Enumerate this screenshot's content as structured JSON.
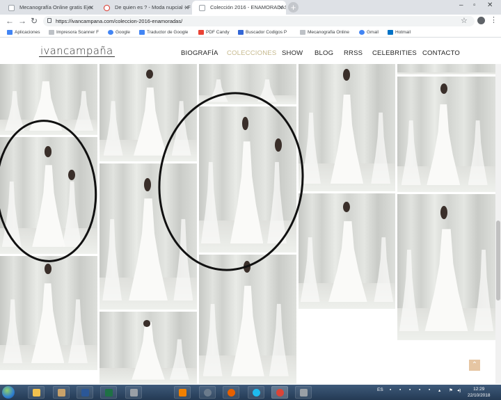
{
  "browser": {
    "tabs": [
      {
        "title": "Mecanografía Online gratis Ejer"
      },
      {
        "title": "De quien es ? - Moda nupcial - F"
      },
      {
        "title": "Colección 2016 - ENAMORADAS",
        "active": true
      }
    ],
    "url": "https://ivancampana.com/coleccion-2016-enamoradas/",
    "bookmarks": [
      {
        "label": "Aplicaciones",
        "icon": "apps-grid-icon",
        "color": "#4285f4"
      },
      {
        "label": "Impresora Scanner F",
        "icon": "page-icon",
        "color": "#9aa0a6"
      },
      {
        "label": "Google",
        "icon": "google-icon",
        "color": "#4285f4"
      },
      {
        "label": "Traductor de Google",
        "icon": "translate-icon",
        "color": "#4285f4"
      },
      {
        "label": "PDF Candy",
        "icon": "candy-icon",
        "color": "#ea4335"
      },
      {
        "label": "Buscador Codigos P",
        "icon": "search-puzzle-icon",
        "color": "#3367d6"
      },
      {
        "label": "Mecanografia Online",
        "icon": "page-icon",
        "color": "#9aa0a6"
      },
      {
        "label": "Gmail",
        "icon": "google-icon",
        "color": "#4285f4"
      },
      {
        "label": "Hotmail",
        "icon": "outlook-icon",
        "color": "#0072c6"
      }
    ]
  },
  "site": {
    "logo": "ivancampaña",
    "nav": [
      {
        "label": "BIOGRAFÍA"
      },
      {
        "label": "COLECCIONES",
        "active": true
      },
      {
        "label": "SHOW"
      },
      {
        "label": "BLOG"
      },
      {
        "label": "RRSS"
      },
      {
        "label": "CELEBRITIES"
      },
      {
        "label": "CONTACTO"
      }
    ],
    "accent_color": "#c6b98d"
  },
  "gallery": {
    "photos": [
      {
        "name": "photo-col1-1"
      },
      {
        "name": "photo-col1-2",
        "circled": true
      },
      {
        "name": "photo-col1-3"
      },
      {
        "name": "photo-col2-1"
      },
      {
        "name": "photo-col2-2"
      },
      {
        "name": "photo-col2-3"
      },
      {
        "name": "photo-col3-1"
      },
      {
        "name": "photo-col3-2",
        "circled": true
      },
      {
        "name": "photo-col3-3"
      },
      {
        "name": "photo-col4-1"
      },
      {
        "name": "photo-col4-2"
      },
      {
        "name": "photo-col5-1"
      },
      {
        "name": "photo-col5-2"
      },
      {
        "name": "photo-col5-3"
      }
    ],
    "back_to_top_icon": "chevron-up-icon"
  },
  "taskbar": {
    "language": "ES",
    "time": "12:29",
    "date": "22/10/2018",
    "apps": [
      "explorer-icon",
      "word-icon",
      "excel-icon",
      "vlc-icon",
      "media-icon",
      "firefox-icon",
      "ie-icon",
      "chrome-icon",
      "app-icon"
    ]
  }
}
